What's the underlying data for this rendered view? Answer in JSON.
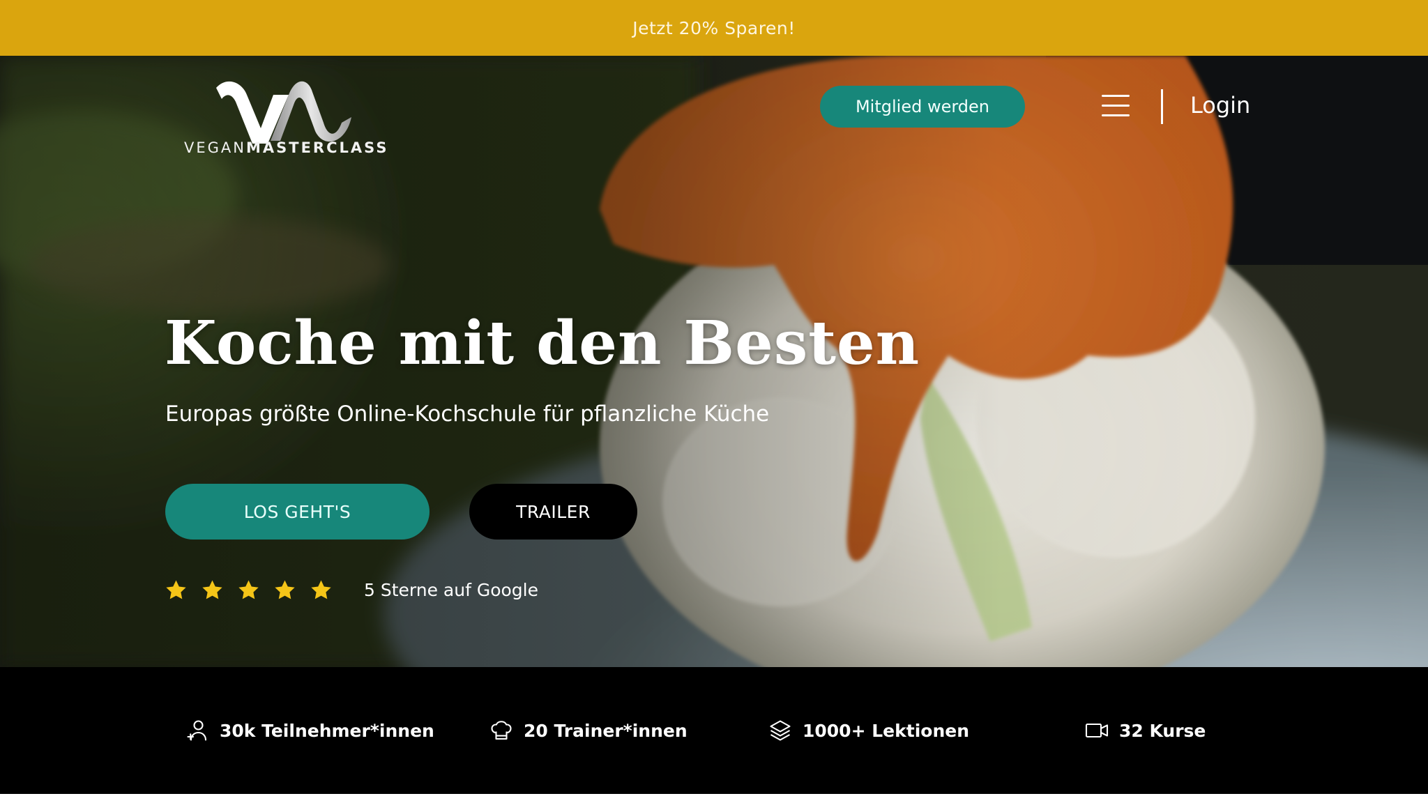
{
  "promo": {
    "text": "Jetzt 20% Sparen!"
  },
  "header": {
    "logo_word_light": "VEGAN",
    "logo_word_bold": "MASTERCLASS",
    "member_button": "Mitglied werden",
    "menu_icon": "hamburger-menu-icon",
    "login_label": "Login"
  },
  "hero": {
    "title": "Koche mit den Besten",
    "subtitle": "Europas größte Online-Kochschule für pflanzliche Küche",
    "primary_button": "LOS GEHT'S",
    "secondary_button": "TRAILER",
    "rating_stars": 5,
    "rating_text": "5 Sterne auf Google"
  },
  "stats": [
    {
      "icon": "user-plus-icon",
      "label": "30k Teilnehmer*innen"
    },
    {
      "icon": "chef-hat-icon",
      "label": "20 Trainer*innen"
    },
    {
      "icon": "layers-icon",
      "label": "1000+ Lektionen"
    },
    {
      "icon": "video-camera-icon",
      "label": "32 Kurse"
    }
  ],
  "colors": {
    "promo_bar": "#daa50e",
    "accent_teal": "#17877a",
    "star": "#f5c518",
    "stats_bar": "#000000"
  }
}
